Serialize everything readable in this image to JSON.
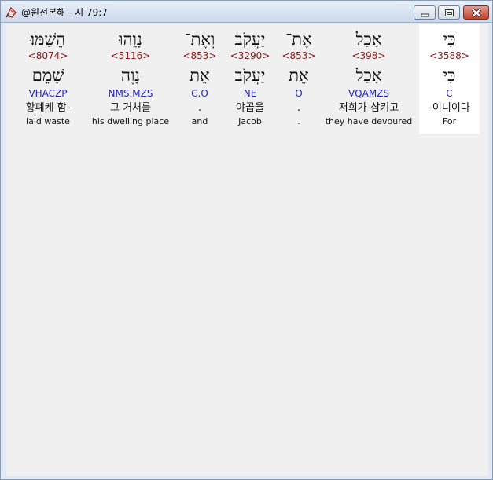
{
  "window": {
    "title": "@원전본해 - 시 79:7",
    "icon": "app-logo-icon",
    "controls": [
      "minimize-icon",
      "maximize-icon",
      "close-icon"
    ]
  },
  "columns": [
    {
      "hebrew": "הֵשַׁמּוּ׃",
      "strong": "<8074>",
      "hebrew_lemma": "שָׁמֵם",
      "morph": "VHACZP",
      "korean": "황폐케 함-",
      "english": "laid waste"
    },
    {
      "hebrew": "נָוֵהוּ",
      "strong": "<5116>",
      "hebrew_lemma": "נָוֶה",
      "morph": "NMS.MZS",
      "korean": "그 거처를",
      "english": "his dwelling place"
    },
    {
      "hebrew": "וְאֶת־",
      "strong": "<853>",
      "hebrew_lemma": "אֵת",
      "morph": "C.O",
      "korean": ".",
      "english": "and"
    },
    {
      "hebrew": "יַעֲקֹב",
      "strong": "<3290>",
      "hebrew_lemma": "יַעֲקֹב",
      "morph": "NE",
      "korean": "야곱을",
      "english": "Jacob"
    },
    {
      "hebrew": "אֶת־",
      "strong": "<853>",
      "hebrew_lemma": "אֵת",
      "morph": "O",
      "korean": ".",
      "english": "."
    },
    {
      "hebrew": "אָכַל",
      "strong": "<398>",
      "hebrew_lemma": "אָכַל",
      "morph": "VQAMZS",
      "korean": "저희가-삼키고",
      "english": "they have devoured"
    },
    {
      "hebrew": "כִּי",
      "strong": "<3588>",
      "hebrew_lemma": "כִּי",
      "morph": "C",
      "korean": "-이니이다",
      "english": "For"
    }
  ]
}
